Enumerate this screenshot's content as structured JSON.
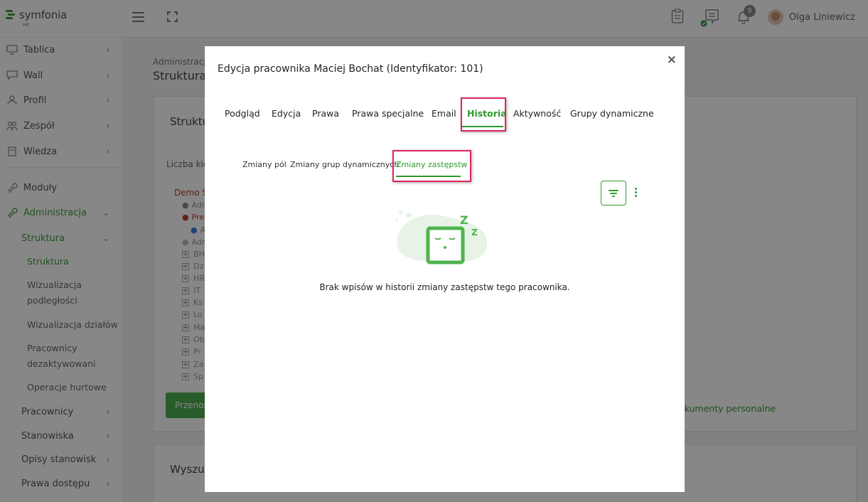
{
  "app": {
    "logo_text": "symfonia",
    "logo_sub": "HR",
    "notification_count": "9",
    "user_name": "Olga Liniewicz"
  },
  "sidebar": {
    "items": [
      {
        "label": "Tablica",
        "icon": "monitor-icon"
      },
      {
        "label": "Wall",
        "icon": "chat-icon"
      },
      {
        "label": "Profil",
        "icon": "user-icon"
      },
      {
        "label": "Zespół",
        "icon": "team-icon"
      },
      {
        "label": "Wiedza",
        "icon": "book-icon"
      },
      {
        "label": "Moduły",
        "icon": "wrench-icon"
      },
      {
        "label": "Administracja",
        "icon": "wrench-icon"
      }
    ],
    "admin_sub": {
      "struktura": "Struktura",
      "struktura_child": "Struktura",
      "wizualizacja_1": "Wizualizacja",
      "wizualizacja_2": "podległości",
      "wizualizacja_dzialow": "Wizualizacja działów",
      "pracownicy_dez_1": "Pracownicy",
      "pracownicy_dez_2": "dezaktywowani",
      "operacje": "Operacje hurtowe",
      "pracownicy": "Pracownicy",
      "stanowiska": "Stanowiska",
      "opisy": "Opisy stanowisk",
      "prawa": "Prawa dostępu"
    }
  },
  "background": {
    "breadcrumb": "Administracja",
    "page_title": "Struktura",
    "card_title": "Struktu",
    "count_label": "Liczba kie",
    "demo_label": "Demo S",
    "tree": [
      "Adm",
      "Pre",
      "A",
      "Adm",
      "BH",
      "Dz",
      "HR",
      "IT",
      "Ks",
      "Lo",
      "Ma",
      "Ob",
      "Pr",
      "Za",
      "Sp"
    ],
    "button": "Przenos",
    "link": "okumenty personalne",
    "card2_title": "Wyszuk"
  },
  "modal": {
    "title": "Edycja pracownika Maciej Bochat (Identyfikator: 101)",
    "close": "×",
    "tabs": [
      "Podgląd",
      "Edycja",
      "Prawa",
      "Prawa specjalne",
      "Email",
      "Historia",
      "Aktywność",
      "Grupy dynamiczne"
    ],
    "active_tab": "Historia",
    "subtabs": [
      "Zmiany pól",
      "Zmiany grup dynamicznych",
      "Zmiany zastępstw"
    ],
    "active_subtab": "Zmiany zastępstw",
    "empty_message": "Brak wpisów w historii zmiany zastępstw tego pracownika.",
    "illustration_letters": [
      "Z",
      "Z"
    ]
  },
  "colors": {
    "accent": "#2e9a2e",
    "highlight": "#e0245e",
    "overlay": "#000000"
  }
}
